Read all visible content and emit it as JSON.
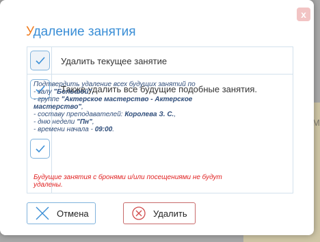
{
  "dialog": {
    "title_first_letter": "У",
    "title_rest": "даление занятия",
    "close_label": "x"
  },
  "options": {
    "current": {
      "label": "Удалить текущее занятие",
      "checked": true
    },
    "future": {
      "label": "Также удалить все будущие подобные занятия.",
      "checked": true
    }
  },
  "details": {
    "intro": "Подтвердить удаление всех будущих занятий по",
    "hall_prefix": "- залу ",
    "hall_value": "\"Большой\"",
    "group_prefix": "- группе ",
    "group_value": "\"Актерское мастерство - Актерское мастерство\"",
    "teachers_prefix": "- составу преподавателей: ",
    "teachers_value": "Королева З. С.",
    "weekday_prefix": "- дню недели ",
    "weekday_value": "\"Пн\"",
    "time_prefix": "- времени начала - ",
    "time_value": "09:00"
  },
  "warning": "Будущие занятия с бронями и/или посещениями не будут удалены.",
  "buttons": {
    "cancel": "Отмена",
    "delete": "Удалить"
  },
  "background": {
    "partial_letter": "М"
  },
  "colors": {
    "accent": "#3a8ed6",
    "title_first": "#f07c1e",
    "warning": "#e02020",
    "delete_border": "#c86a6a"
  }
}
